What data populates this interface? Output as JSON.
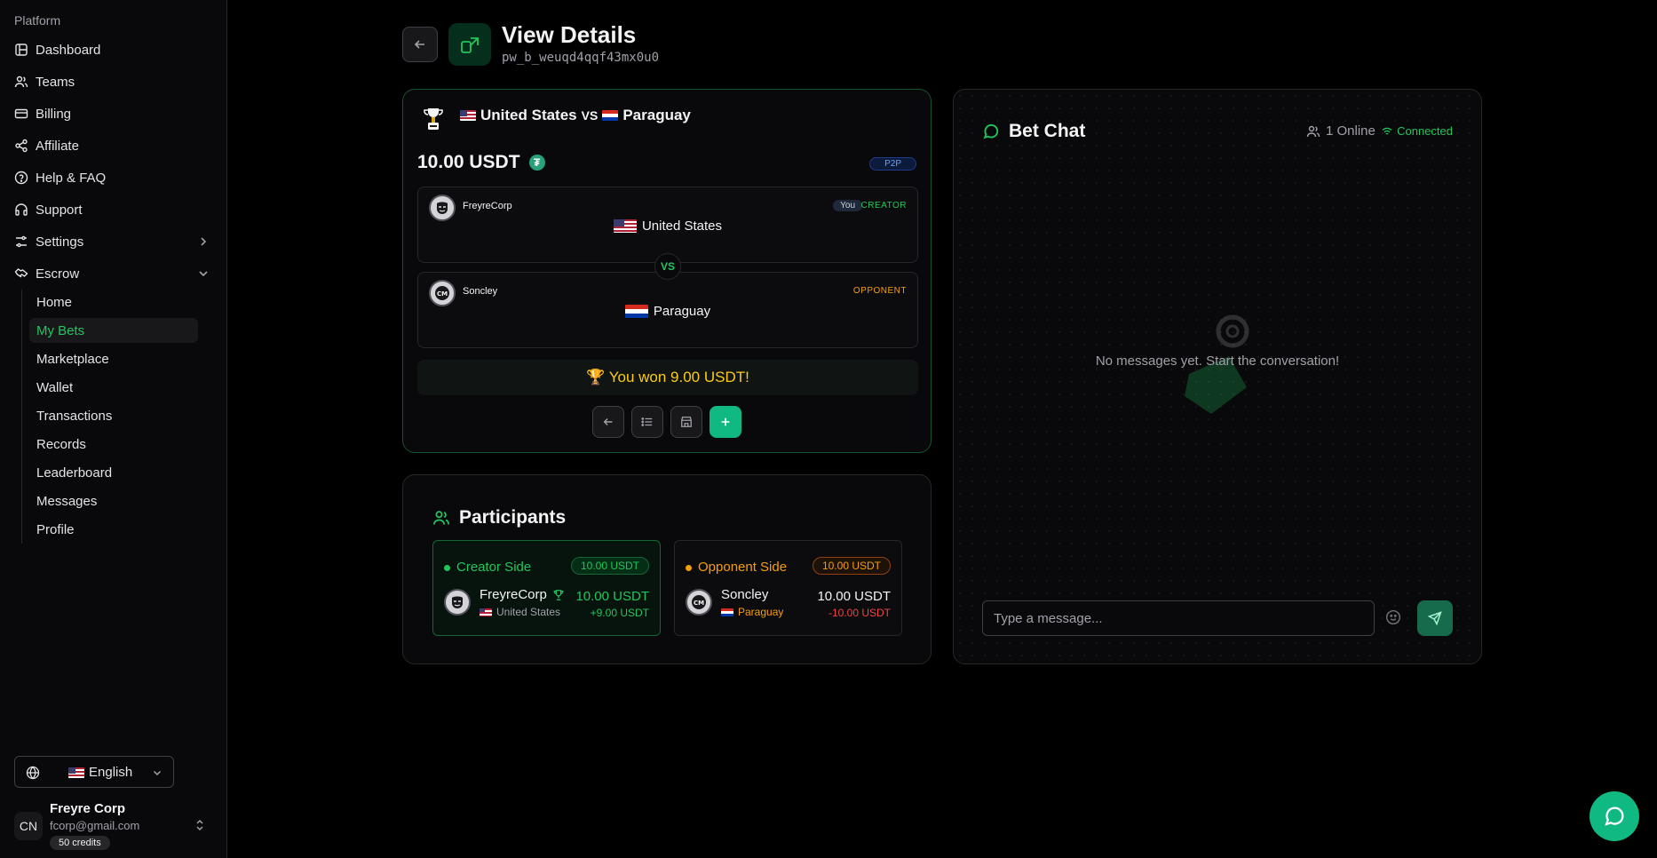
{
  "sidebar": {
    "group_label": "Platform",
    "items": [
      {
        "label": "Dashboard",
        "icon": "dashboard-icon"
      },
      {
        "label": "Teams",
        "icon": "users-icon"
      },
      {
        "label": "Billing",
        "icon": "credit-card-icon"
      },
      {
        "label": "Affiliate",
        "icon": "share-icon"
      },
      {
        "label": "Help & FAQ",
        "icon": "help-circle-icon"
      },
      {
        "label": "Support",
        "icon": "headphones-icon"
      },
      {
        "label": "Settings",
        "icon": "sliders-icon"
      },
      {
        "label": "Escrow",
        "icon": "handshake-icon"
      }
    ],
    "escrow_sub": [
      "Home",
      "My Bets",
      "Marketplace",
      "Wallet",
      "Transactions",
      "Records",
      "Leaderboard",
      "Messages",
      "Profile"
    ],
    "active_sub": "My Bets",
    "language": "English",
    "user": {
      "initials": "CN",
      "name": "Freyre Corp",
      "email": "fcorp@gmail.com",
      "credits": "50 credits"
    }
  },
  "header": {
    "title": "View Details",
    "bet_id": "pw_b_weuqd4qqf43mx0u0"
  },
  "bet": {
    "team_a": "United States",
    "vs": "VS",
    "team_b": "Paraguay",
    "amount": "10.00 USDT",
    "currency_symbol": "₮",
    "type_badge": "P2P",
    "creator": {
      "name": "FreyreCorp",
      "team": "United States",
      "you_badge": "You",
      "role": "CREATOR"
    },
    "opponent": {
      "name": "Soncley",
      "team": "Paraguay",
      "role": "OPPONENT"
    },
    "vs_small": "VS",
    "win_message": "🏆 You won 9.00 USDT!"
  },
  "participants": {
    "title": "Participants",
    "creator_side": {
      "label": "Creator Side",
      "pill": "10.00 USDT",
      "name": "FreyreCorp",
      "team": "United States",
      "amount": "10.00 USDT",
      "delta": "+9.00 USDT"
    },
    "opponent_side": {
      "label": "Opponent Side",
      "pill": "10.00 USDT",
      "name": "Soncley",
      "team": "Paraguay",
      "amount": "10.00 USDT",
      "delta": "-10.00 USDT"
    }
  },
  "chat": {
    "title": "Bet Chat",
    "online": "1 Online",
    "status": "Connected",
    "empty_text": "No messages yet. Start the conversation!",
    "input_placeholder": "Type a message..."
  },
  "colors": {
    "accent": "#22c55e",
    "warning": "#f59e0b",
    "danger": "#ef4444",
    "win": "#facc15"
  }
}
